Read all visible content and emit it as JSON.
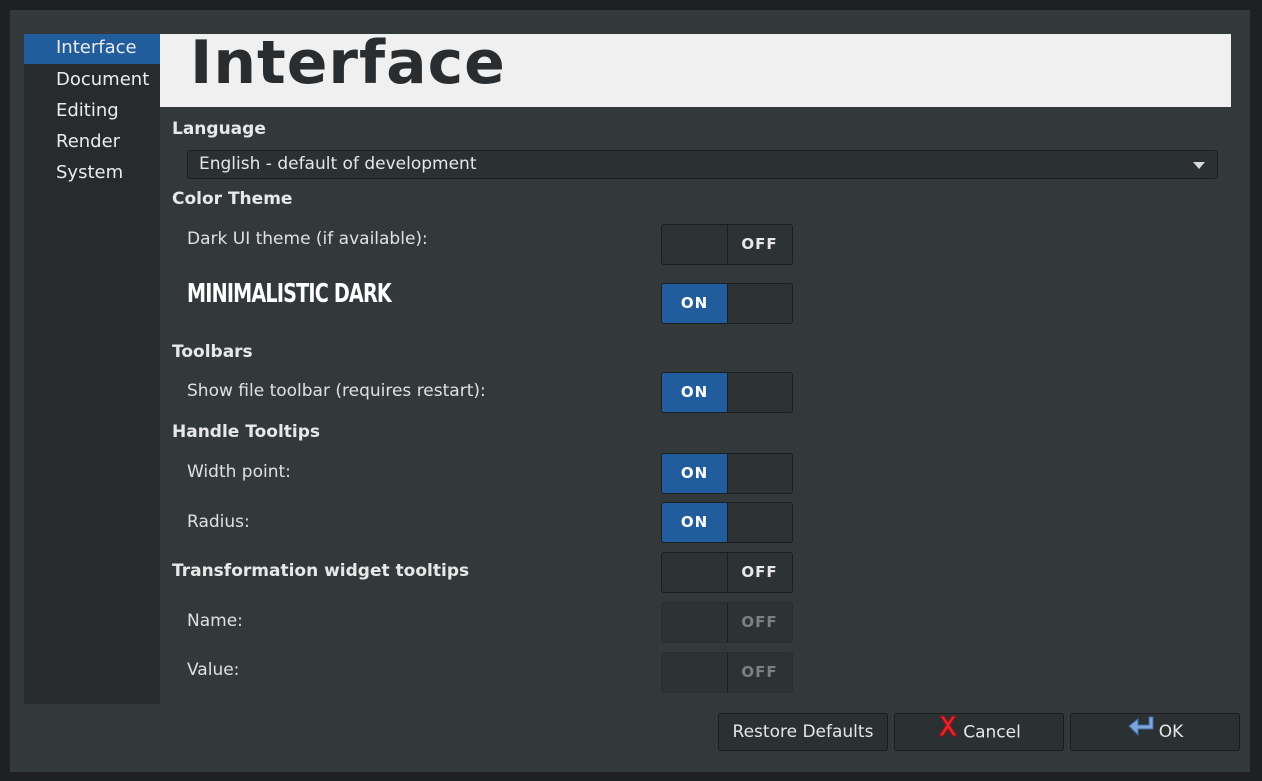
{
  "sidebar": {
    "items": [
      {
        "label": "Interface"
      },
      {
        "label": "Document"
      },
      {
        "label": "Editing"
      },
      {
        "label": "Render"
      },
      {
        "label": "System"
      }
    ]
  },
  "banner": {
    "title": "Interface"
  },
  "language": {
    "section": "Language",
    "selected": "English - default of development"
  },
  "color_theme": {
    "section": "Color Theme",
    "dark_ui_label": "Dark UI theme (if available):",
    "dark_ui_state": "OFF",
    "theme_name": "MINIMALISTIC DARK",
    "theme_state": "ON"
  },
  "toolbars": {
    "section": "Toolbars",
    "file_toolbar_label": "Show file toolbar (requires restart):",
    "file_toolbar_state": "ON"
  },
  "handle_tooltips": {
    "section": "Handle Tooltips",
    "width_label": "Width point:",
    "width_state": "ON",
    "radius_label": "Radius:",
    "radius_state": "ON"
  },
  "transformation": {
    "section": "Transformation widget tooltips",
    "state": "OFF",
    "name_label": "Name:",
    "name_state": "OFF",
    "value_label": "Value:",
    "value_state": "OFF"
  },
  "buttons": {
    "restore": "Restore Defaults",
    "cancel": "Cancel",
    "ok": "OK"
  },
  "colors": {
    "accent": "#215d9c",
    "background": "#33393b",
    "sidebar": "#272b2d",
    "cancel_icon": "#e0262b",
    "ok_icon": "#7fa6dc"
  }
}
